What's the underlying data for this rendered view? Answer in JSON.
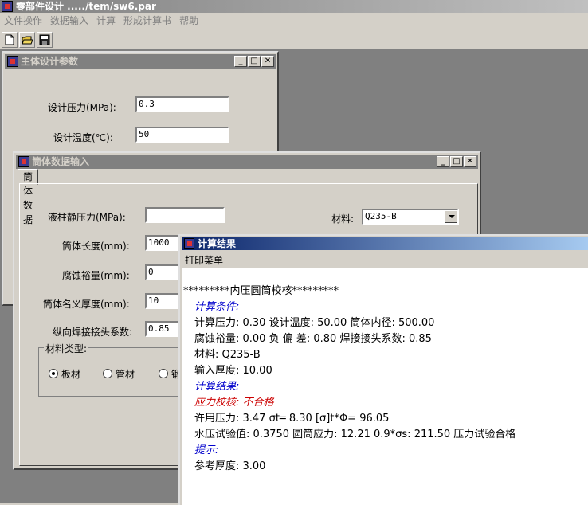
{
  "app": {
    "title": "零部件设计 ...../tem/sw6.par"
  },
  "menu": [
    "文件操作",
    "数据输入",
    "计算",
    "形成计算书",
    "帮助"
  ],
  "toolbar": {
    "new_icon": "new-file-icon",
    "open_icon": "open-folder-icon",
    "save_icon": "save-disk-icon"
  },
  "main_params": {
    "title": "主体设计参数",
    "pressure_label": "设计压力(MPa):",
    "pressure_value": "0.3",
    "temp_label": "设计温度(℃):",
    "temp_value": "50"
  },
  "cylinder": {
    "title": "筒体数据输入",
    "tab": "筒体数据",
    "liquid_label": "液柱静压力(MPa):",
    "liquid_value": "",
    "material_label": "材料:",
    "material_value": "Q235-B",
    "length_label": "筒体长度(mm):",
    "length_value": "1000",
    "corrosion_label": "腐蚀裕量(mm):",
    "corrosion_value": "0",
    "thickness_label": "筒体名义厚度(mm):",
    "thickness_value": "10",
    "weld_label": "纵向焊接接头系数:",
    "weld_value": "0.85",
    "group_label": "材料类型:",
    "radio1": "板材",
    "radio2": "管材",
    "radio3": "锻"
  },
  "result": {
    "title": "计算结果",
    "menu": "打印菜单",
    "heading": "*********内压圆筒校核*********",
    "cond_title": "计算条件:",
    "line1": "计算压力: 0.30    设计温度: 50.00    筒体内径: 500.00",
    "line2": "腐蚀裕量: 0.00    负 偏 差: 0.80    焊接接头系数: 0.85",
    "line3": "材料: Q235-B",
    "line4": "输入厚度: 10.00",
    "res_title": "计算结果:",
    "stress": "应力校核: 不合格",
    "line5": "许用压力:  3.47    σt═  8.30    [σ]t*Φ=  96.05",
    "line6": "水压试验值:  0.3750   圆筒应力: 12.21   0.9*σs: 211.50   压力试验合格",
    "tip_title": "提示:",
    "line7": "参考厚度: 3.00"
  }
}
